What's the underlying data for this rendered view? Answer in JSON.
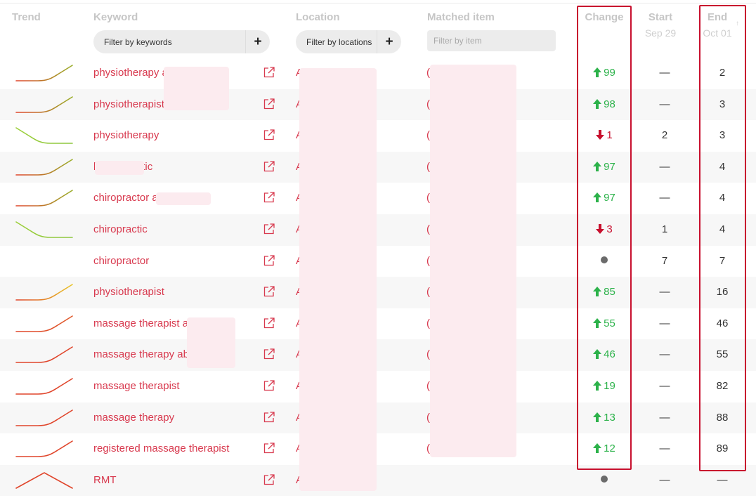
{
  "headers": {
    "trend": "Trend",
    "keyword": "Keyword",
    "location": "Location",
    "matched_item": "Matched item",
    "change": "Change",
    "start": "Start",
    "start_date": "Sep 29",
    "end": "End",
    "end_date": "Oct 01",
    "sort_glyph": "↑"
  },
  "filters": {
    "keywords_label": "Filter by keywords",
    "locations_label": "Filter by locations",
    "item_placeholder": "Filter by item",
    "plus": "+"
  },
  "colors": {
    "keyword": "#d8394e",
    "up": "#2cb24a",
    "down": "#c8102e",
    "highlight_box": "#c8102e"
  },
  "rows": [
    {
      "trend": "up",
      "trend_colors": [
        "#e0452b",
        "#9aae2a"
      ],
      "keyword": "physiotherapy a",
      "location": "A",
      "matched": "(",
      "dir": "up",
      "change": "99",
      "start": "—",
      "end": "2"
    },
    {
      "trend": "up",
      "trend_colors": [
        "#e0452b",
        "#9aae2a"
      ],
      "keyword": "physiotherapist",
      "location": "A",
      "matched": "(",
      "dir": "up",
      "change": "98",
      "start": "—",
      "end": "3"
    },
    {
      "trend": "down",
      "trend_colors": [
        "#9ccf3a",
        "#8dc63f"
      ],
      "keyword": "physiotherapy",
      "location": "A",
      "matched": "(",
      "dir": "down",
      "change": "1",
      "start": "2",
      "end": "3"
    },
    {
      "trend": "up",
      "trend_colors": [
        "#e0452b",
        "#9aae2a"
      ],
      "keyword": "l chiropractic",
      "location": "A",
      "matched": "(",
      "dir": "up",
      "change": "97",
      "start": "—",
      "end": "4"
    },
    {
      "trend": "up",
      "trend_colors": [
        "#e0452b",
        "#9aae2a"
      ],
      "keyword": "chiropractor a",
      "location": "A",
      "matched": "(",
      "dir": "up",
      "change": "97",
      "start": "—",
      "end": "4"
    },
    {
      "trend": "down",
      "trend_colors": [
        "#9ccf3a",
        "#8dc63f"
      ],
      "keyword": "chiropractic",
      "location": "A",
      "matched": "(",
      "dir": "down",
      "change": "3",
      "start": "1",
      "end": "4"
    },
    {
      "trend": "flat",
      "trend_colors": [
        "#c9d62b",
        "#c9d62b"
      ],
      "keyword": "chiropractor",
      "location": "A",
      "matched": "(",
      "dir": "none",
      "change": "",
      "start": "7",
      "end": "7"
    },
    {
      "trend": "up",
      "trend_colors": [
        "#e0452b",
        "#e9c52a"
      ],
      "keyword": "physiotherapist",
      "location": "A",
      "matched": "(",
      "dir": "up",
      "change": "85",
      "start": "—",
      "end": "16"
    },
    {
      "trend": "up",
      "trend_colors": [
        "#e0452b",
        "#e05a2b"
      ],
      "keyword": "massage therapist a",
      "location": "A",
      "matched": "(",
      "dir": "up",
      "change": "55",
      "start": "—",
      "end": "46"
    },
    {
      "trend": "up",
      "trend_colors": [
        "#e0452b",
        "#e0452b"
      ],
      "keyword": "massage therapy ab",
      "location": "A",
      "matched": "(",
      "dir": "up",
      "change": "46",
      "start": "—",
      "end": "55"
    },
    {
      "trend": "up",
      "trend_colors": [
        "#e0452b",
        "#e0452b"
      ],
      "keyword": "massage therapist",
      "location": "A",
      "matched": "(",
      "dir": "up",
      "change": "19",
      "start": "—",
      "end": "82"
    },
    {
      "trend": "up",
      "trend_colors": [
        "#e0452b",
        "#e0452b"
      ],
      "keyword": "massage therapy",
      "location": "A",
      "matched": "(",
      "dir": "up",
      "change": "13",
      "start": "—",
      "end": "88"
    },
    {
      "trend": "up",
      "trend_colors": [
        "#e0452b",
        "#e0452b"
      ],
      "keyword": "registered massage therapist",
      "location": "A",
      "matched": "(",
      "dir": "up",
      "change": "12",
      "start": "—",
      "end": "89"
    },
    {
      "trend": "hump",
      "trend_colors": [
        "#e0452b",
        "#e0452b"
      ],
      "keyword": "RMT",
      "location": "A",
      "matched": "",
      "dir": "none",
      "change": "",
      "start": "—",
      "end": "—"
    }
  ]
}
